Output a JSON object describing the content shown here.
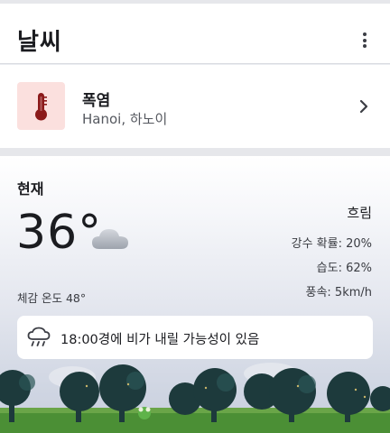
{
  "header": {
    "title": "날씨",
    "menu_icon": "more-vert-icon"
  },
  "alert": {
    "icon": "thermometer-icon",
    "title": "폭염",
    "location": "Hanoi, 하노이",
    "chevron_icon": "chevron-right-icon"
  },
  "current": {
    "label": "현재",
    "temperature": "36°",
    "weather_icon": "cloud-icon",
    "feels_like": "체감 온도 48°",
    "condition": "흐림",
    "precipitation": "강수 확률: 20%",
    "humidity": "습도: 62%",
    "wind": "풍속: 5km/h"
  },
  "forecast_notice": {
    "icon": "rain-cloud-icon",
    "text": "18:00경에 비가 내릴 가능성이 있음"
  },
  "colors": {
    "alert_icon_bg": "#fbe0de",
    "thermometer_red": "#8b1a1a",
    "tree_dark": "#1d3a3c",
    "grass": "#3f8a2e"
  }
}
